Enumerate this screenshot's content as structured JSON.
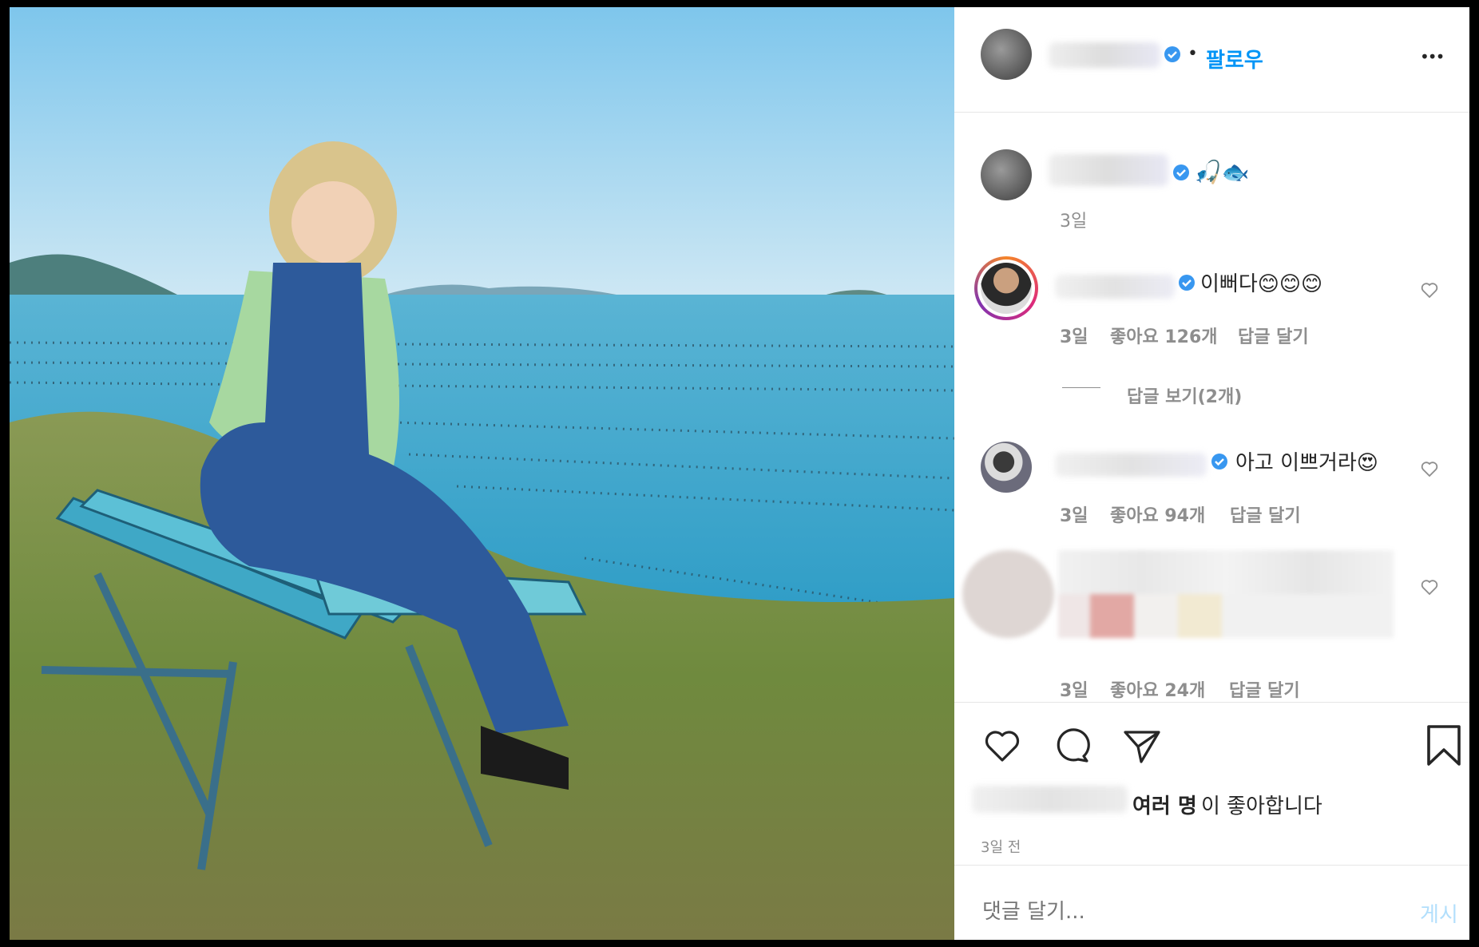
{
  "header": {
    "follow_label": "팔로우",
    "more_label": "•••"
  },
  "caption": {
    "text": "🎣🐟",
    "time": "3일"
  },
  "comments": [
    {
      "text": "이뻐다😊😊😊",
      "time": "3일",
      "likes": "좋아요 126개",
      "reply_label": "답글 달기",
      "view_replies": "답글 보기(2개)"
    },
    {
      "text": "아고 이쁘거라😍",
      "time": "3일",
      "likes": "좋아요 94개",
      "reply_label": "답글 달기"
    },
    {
      "text": "",
      "time": "3일",
      "likes": "좋아요 24개",
      "reply_label": "답글 달기"
    }
  ],
  "likes_summary": {
    "bold": "여러 명",
    "rest": "이 좋아합니다"
  },
  "post_time": "3일 전",
  "comment_box": {
    "placeholder": "댓글 달기...",
    "post_label": "게시"
  },
  "icons": [
    "heart-icon",
    "comment-icon",
    "share-icon",
    "bookmark-icon",
    "verified-icon",
    "more-icon"
  ],
  "colors": {
    "link_blue": "#0095f6",
    "meta_gray": "#8e8e8e",
    "verified": "#3897f0"
  }
}
